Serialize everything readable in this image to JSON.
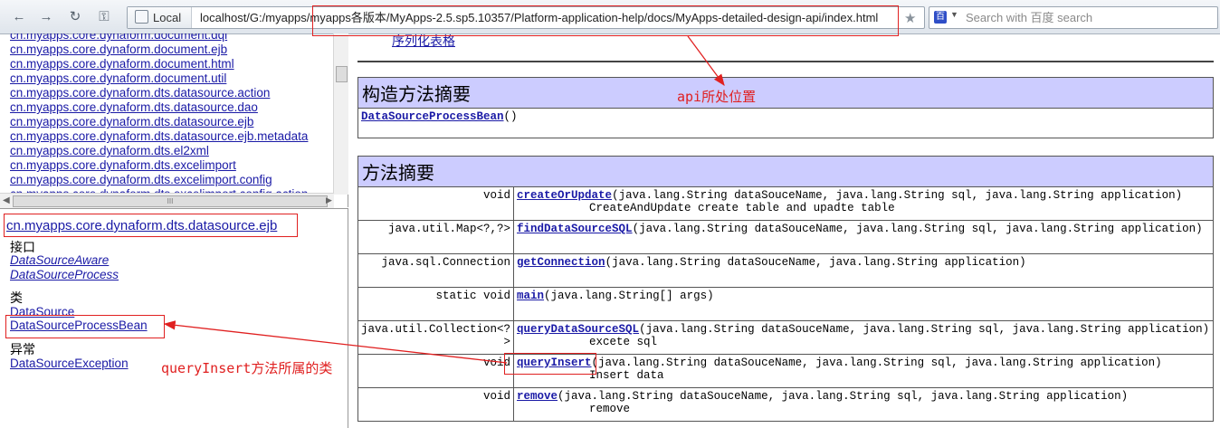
{
  "toolbar": {
    "back_icon": "←",
    "forward_icon": "→",
    "reload_icon": "↻",
    "key_icon": "⚿",
    "site_label": "Local",
    "url": "localhost/G:/myapps/myapps各版本/MyApps-2.5.sp5.10357/Platform-application-help/docs/MyApps-detailed-design-api/index.html",
    "star_icon": "★",
    "search_engine_icon": "百",
    "search_placeholder": "Search with 百度 search"
  },
  "package_frame": {
    "packages": [
      "cn.myapps.core.dynaform.document.dql",
      "cn.myapps.core.dynaform.document.ejb",
      "cn.myapps.core.dynaform.document.html",
      "cn.myapps.core.dynaform.document.util",
      "cn.myapps.core.dynaform.dts.datasource.action",
      "cn.myapps.core.dynaform.dts.datasource.dao",
      "cn.myapps.core.dynaform.dts.datasource.ejb",
      "cn.myapps.core.dynaform.dts.datasource.ejb.metadata",
      "cn.myapps.core.dynaform.dts.el2xml",
      "cn.myapps.core.dynaform.dts.excelimport",
      "cn.myapps.core.dynaform.dts.excelimport.config",
      "cn.myapps.core.dynaform.dts.excelimport.config.action"
    ],
    "hscroll_grip": "III"
  },
  "class_frame": {
    "package_title": "cn.myapps.core.dynaform.dts.datasource.ejb",
    "interfaces_header": "接口",
    "interfaces": [
      "DataSourceAware",
      "DataSourceProcess"
    ],
    "classes_header": "类",
    "classes": [
      "DataSource",
      "DataSourceProcessBean"
    ],
    "exceptions_header": "异常",
    "exceptions": [
      "DataSourceException"
    ]
  },
  "content": {
    "top_link": "序列化表格",
    "constructor_summary": {
      "title": "构造方法摘要",
      "name": "DataSourceProcessBean",
      "params": "()"
    },
    "method_summary": {
      "title": "方法摘要",
      "rows": [
        {
          "ret": "void",
          "name": "createOrUpdate",
          "params": "(java.lang.String dataSouceName, java.lang.String sql, java.lang.String application)",
          "desc": "CreateAndUpdate create table and upadte table"
        },
        {
          "ret": "java.util.Map<?,?>",
          "name": "findDataSourceSQL",
          "params": "(java.lang.String dataSouceName, java.lang.String sql, java.lang.String application)",
          "desc": ""
        },
        {
          "ret": "java.sql.Connection",
          "name": "getConnection",
          "params": "(java.lang.String dataSouceName, java.lang.String application)",
          "desc": ""
        },
        {
          "ret": "static void",
          "name": "main",
          "params": "(java.lang.String[] args)",
          "desc": ""
        },
        {
          "ret": "java.util.Collection<? >",
          "name": "queryDataSourceSQL",
          "params": "(java.lang.String dataSouceName, java.lang.String sql, java.lang.String application)",
          "desc": "excete sql"
        },
        {
          "ret": "void",
          "name": "queryInsert",
          "params": "(java.lang.String dataSouceName, java.lang.String sql, java.lang.String application)",
          "desc": "Insert data"
        },
        {
          "ret": "void",
          "name": "remove",
          "params": "(java.lang.String dataSouceName, java.lang.String sql, java.lang.String application)",
          "desc": "remove"
        }
      ]
    }
  },
  "annotations": {
    "api_location": "api所处位置",
    "query_insert_class": "queryInsert方法所属的类",
    "color": "#e02020"
  }
}
